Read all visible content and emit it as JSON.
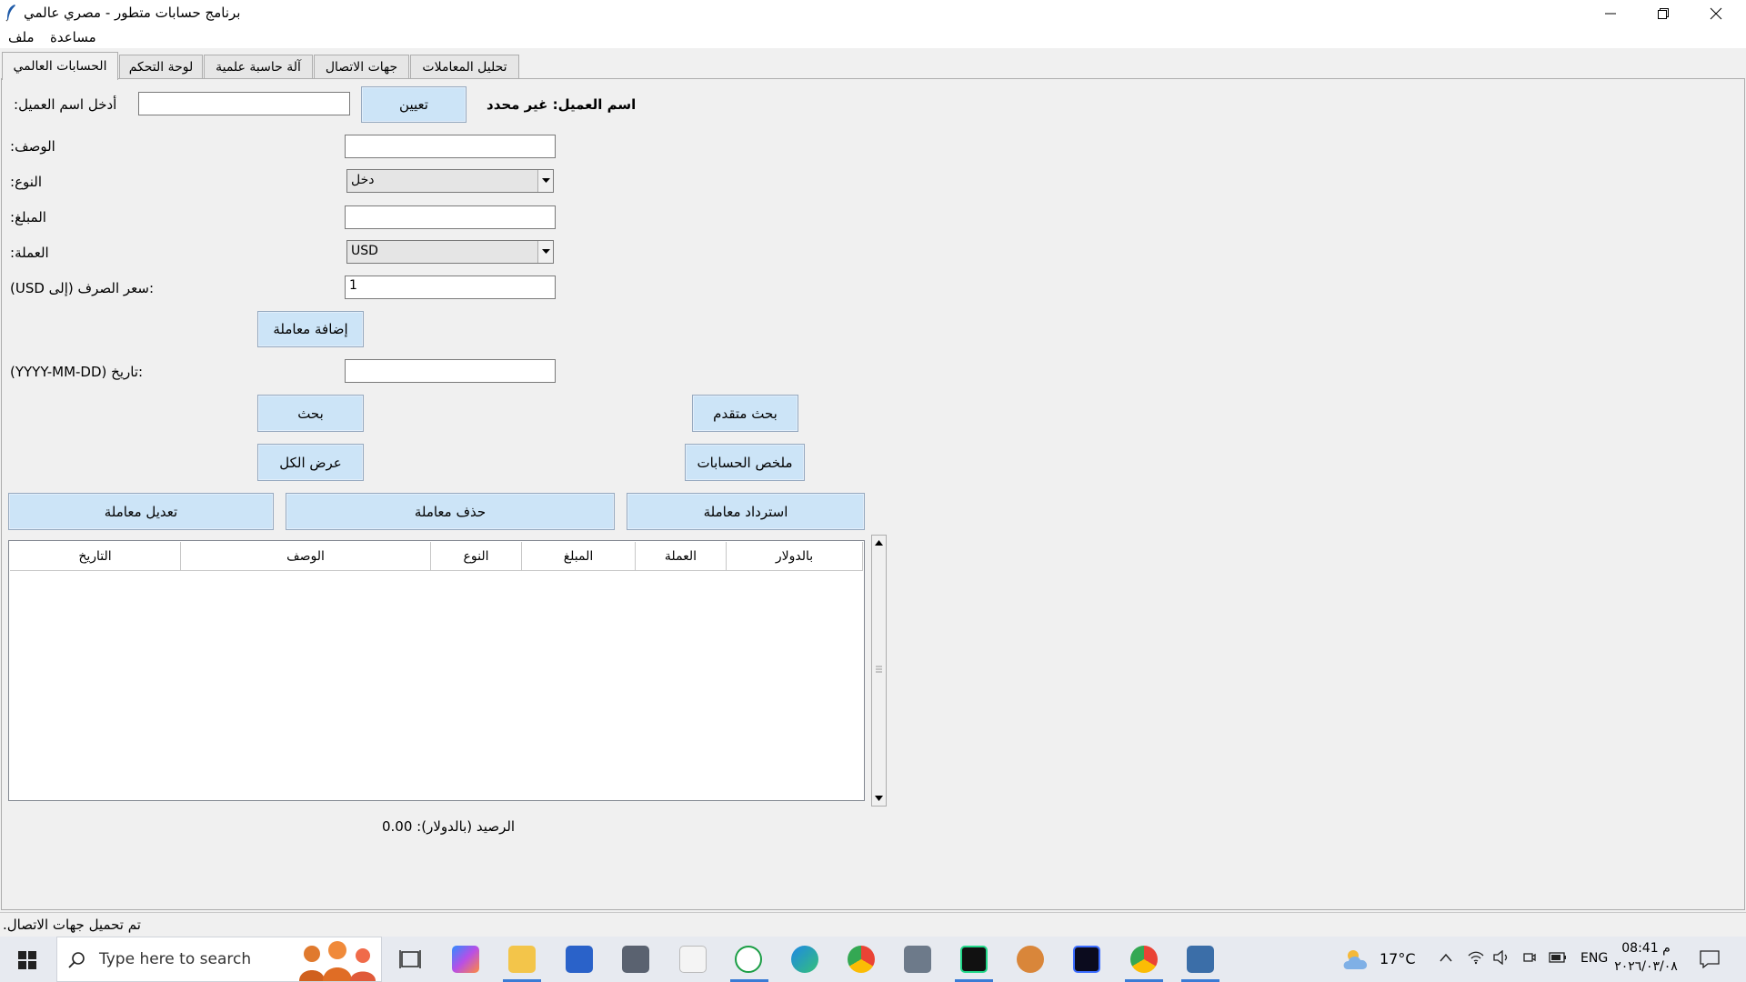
{
  "window": {
    "title": "برنامج حسابات متطور - مصري عالمي"
  },
  "menu": {
    "file": "ملف",
    "help": "مساعدة"
  },
  "tabs": [
    {
      "label": "الحسابات العالمي",
      "active": true
    },
    {
      "label": "لوحة التحكم",
      "active": false
    },
    {
      "label": "آلة حاسبة علمية",
      "active": false
    },
    {
      "label": "جهات الاتصال",
      "active": false
    },
    {
      "label": "تحليل المعاملات",
      "active": false
    }
  ],
  "form": {
    "client_name_label": ":أدخل اسم العميل",
    "client_name_value": "",
    "assign_button": "تعيين",
    "client_status": "اسم العميل: غير محدد",
    "description_label": ":الوصف",
    "description_value": "",
    "type_label": ":النوع",
    "type_value": "دخل",
    "amount_label": ":المبلغ",
    "amount_value": "",
    "currency_label": ":العملة",
    "currency_value": "USD",
    "rate_label": "(USD إلى) سعر الصرف:",
    "rate_value": "1",
    "add_button": "إضافة معاملة",
    "date_label": "(YYYY-MM-DD) تاريخ:",
    "date_value": ""
  },
  "actions": {
    "search": "بحث",
    "advanced_search": "بحث متقدم",
    "show_all": "عرض الكل",
    "accounts_summary": "ملخص الحسابات",
    "edit_transaction": "تعديل معاملة",
    "delete_transaction": "حذف معاملة",
    "restore_transaction": "استرداد معاملة"
  },
  "table": {
    "columns": [
      "التاريخ",
      "الوصف",
      "النوع",
      "المبلغ",
      "العملة",
      "بالدولار"
    ],
    "rows": []
  },
  "balance": "الرصيد (بالدولار): 0.00",
  "status": ".تم تحميل جهات الاتصال",
  "taskbar": {
    "search_placeholder": "Type here to search",
    "temperature": "17°C",
    "language": "ENG",
    "time": "08:41 م",
    "date": "٢٠٢٦/٠٣/٠٨",
    "icons": [
      "taskview-icon",
      "copilot-icon",
      "file-explorer-icon",
      "store-icon",
      "camera-icon",
      "notepad-icon",
      "whatsapp-icon",
      "edge-icon",
      "chrome-icon",
      "calculator-icon",
      "pycharm-icon",
      "game-icon",
      "intellij-icon",
      "chrome-profile-icon",
      "python-app-icon"
    ]
  }
}
